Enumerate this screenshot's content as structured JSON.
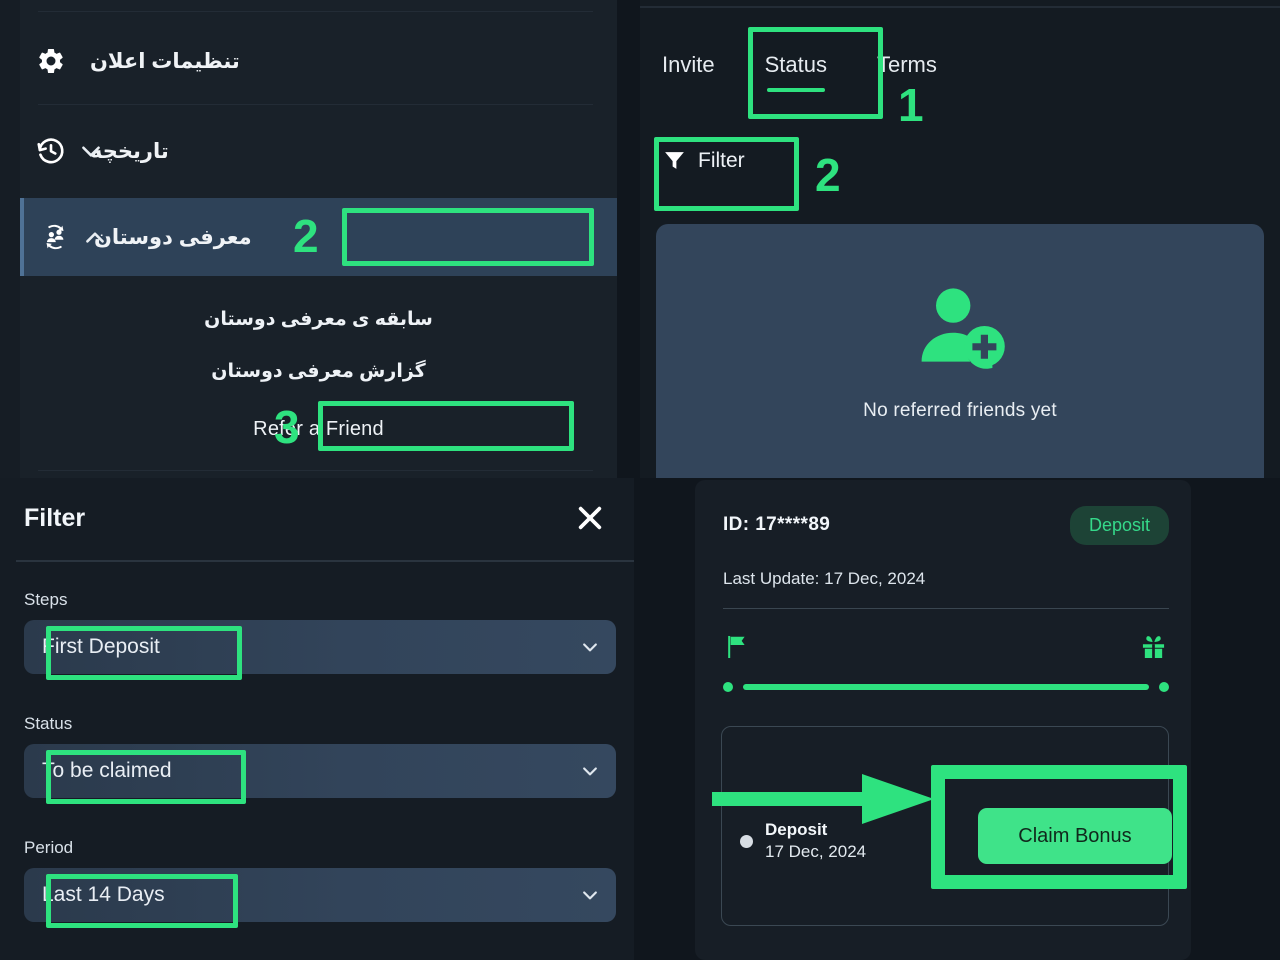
{
  "colors": {
    "accent_green": "#2ee27f",
    "button_green": "#3fe389",
    "badge_bg": "#1d4336",
    "badge_text": "#35d98a",
    "panel_bg": "#192129",
    "card_bg": "#33455b",
    "selected_row": "#2e4258"
  },
  "sidebar": {
    "items": [
      {
        "label": "تنظیمات اعلان",
        "icon": "gear-icon",
        "chevron": ""
      },
      {
        "label": "تاریخچه",
        "icon": "history-icon",
        "chevron": "chevron-down-icon"
      },
      {
        "label": "معرفی دوستان",
        "icon": "refer-friends-icon",
        "chevron": "chevron-up-icon"
      }
    ],
    "sub_items": [
      {
        "label": "سابقه ی معرفی دوستان"
      },
      {
        "label": "گزارش معرفی دوستان"
      },
      {
        "label": "Refer a Friend"
      }
    ],
    "annotations": [
      {
        "number": "2",
        "target": "معرفی دوستان"
      },
      {
        "number": "3",
        "target": "Refer a Friend"
      }
    ]
  },
  "referral_page": {
    "tabs": [
      {
        "label": "Invite",
        "active": false
      },
      {
        "label": "Status",
        "active": true
      },
      {
        "label": "Terms",
        "active": false
      }
    ],
    "filter_button": {
      "label": "Filter",
      "icon": "funnel-icon"
    },
    "empty_state": {
      "icon": "person-add-icon",
      "text": "No referred friends yet"
    },
    "annotations": [
      {
        "number": "1",
        "target": "Status"
      },
      {
        "number": "2",
        "target": "Filter"
      }
    ]
  },
  "filter_drawer": {
    "title": "Filter",
    "close_icon": "close-icon",
    "fields": [
      {
        "label": "Steps",
        "value": "First Deposit",
        "caret": "chevron-down-icon"
      },
      {
        "label": "Status",
        "value": "To be claimed",
        "caret": "chevron-down-icon"
      },
      {
        "label": "Period",
        "value": "Last 14 Days",
        "caret": "chevron-down-icon"
      }
    ]
  },
  "status_card": {
    "id": "ID: 17****89",
    "badge": "Deposit",
    "last_update": "Last Update: 17 Dec, 2024",
    "milestone_start_icon": "flag-icon",
    "milestone_end_icon": "gift-icon",
    "timeline": {
      "entry_name": "Deposit",
      "entry_date": "17 Dec, 2024"
    },
    "claim_button": "Claim Bonus"
  }
}
